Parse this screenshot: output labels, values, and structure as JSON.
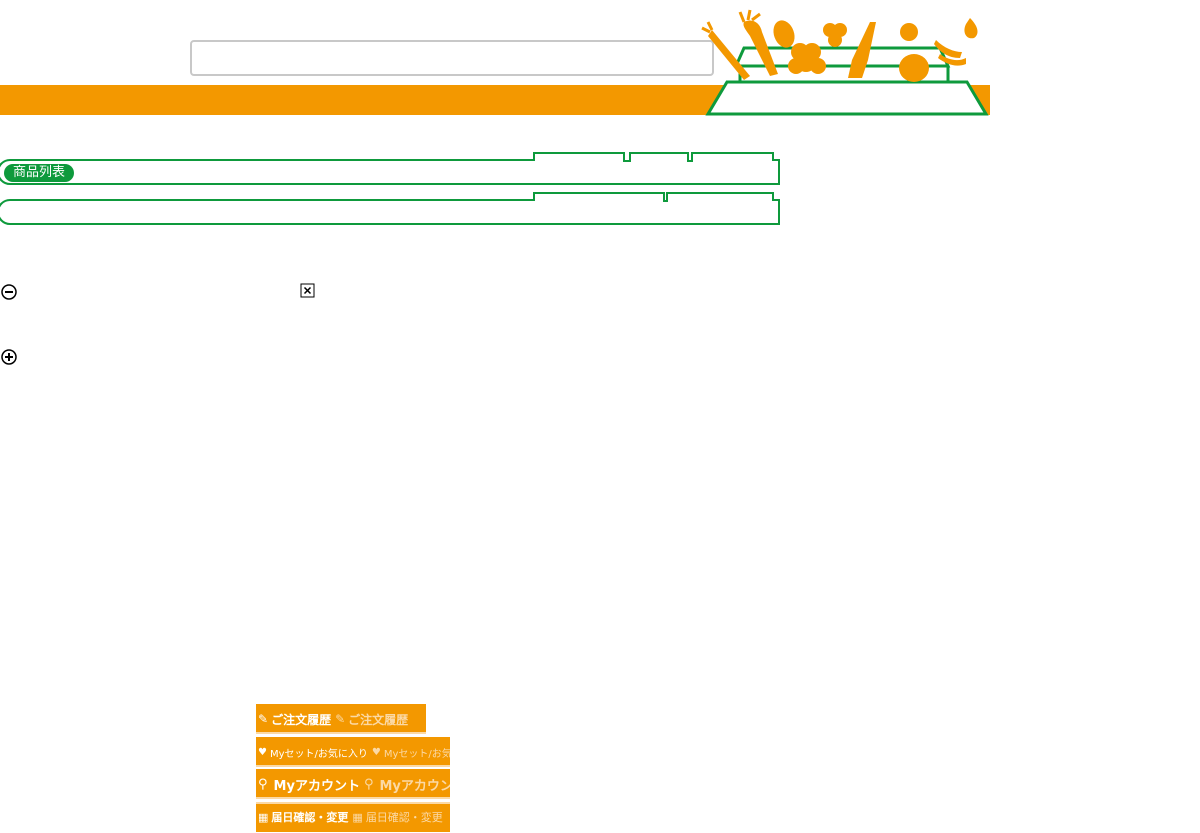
{
  "header": {
    "search_value": ""
  },
  "product_list": {
    "label": "商品列表"
  },
  "menu": [
    {
      "label": "ご注文履歴",
      "icon": "notepad-icon"
    },
    {
      "label": "Myセット/お気に入り",
      "icon": "heart-icon"
    },
    {
      "label": "Myアカウント",
      "icon": "key-icon"
    },
    {
      "label": "届日確認・変更",
      "icon": "calendar-icon"
    }
  ],
  "colors": {
    "orange": "#f39800",
    "green": "#0e9a3c",
    "light_orange": "#fbd9a5"
  }
}
